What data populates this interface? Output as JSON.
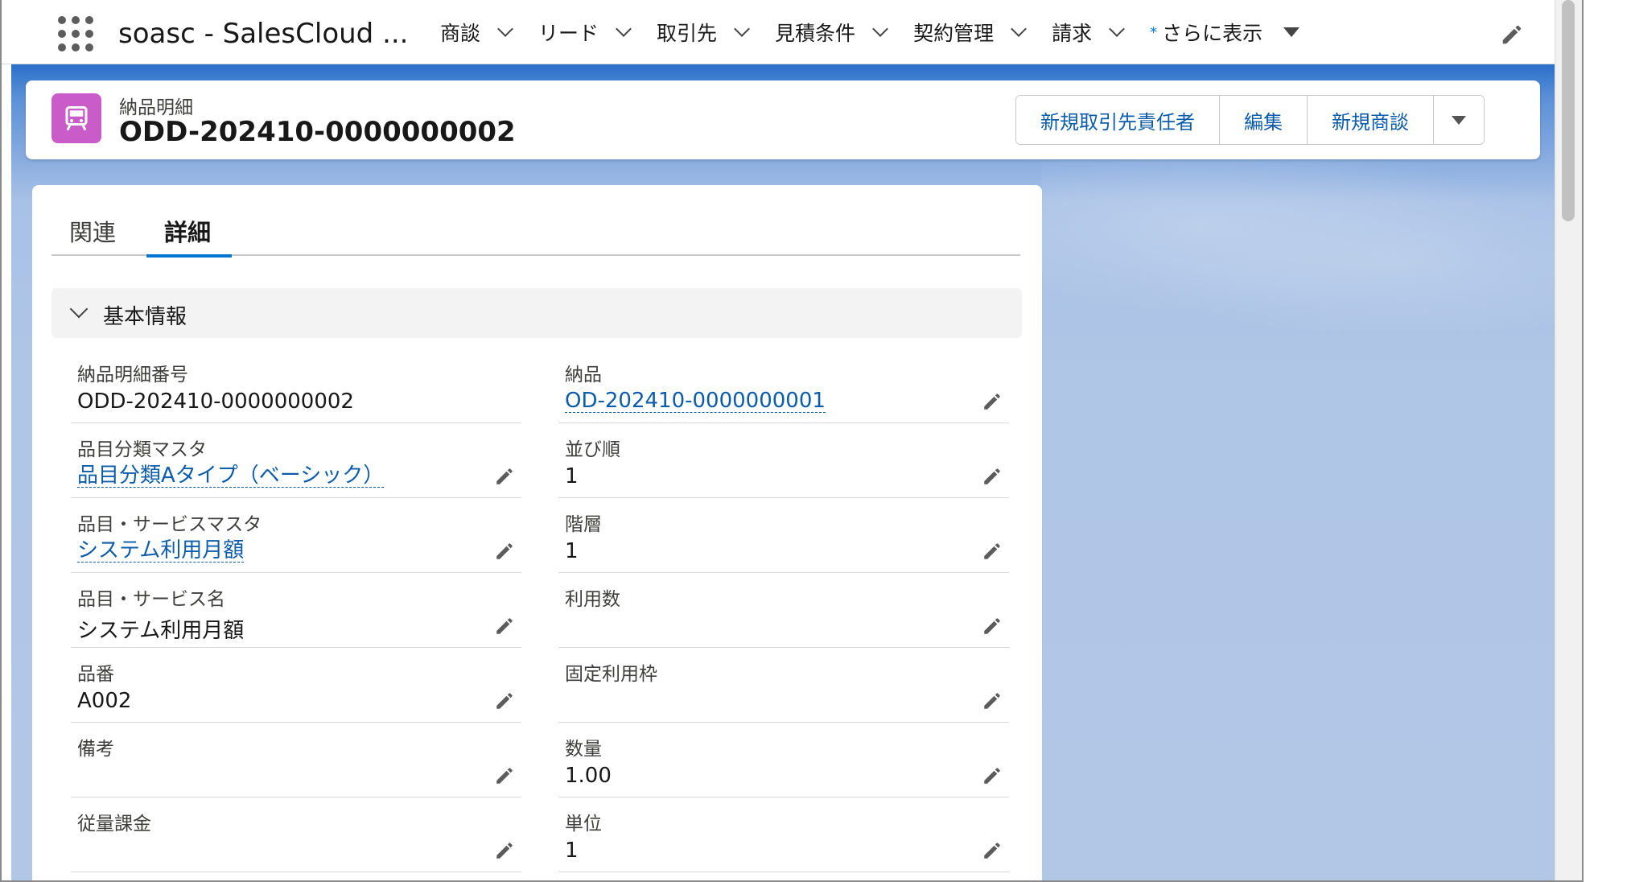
{
  "topnav": {
    "app_name": "soasc - SalesCloud ...",
    "items": [
      {
        "label": "商談"
      },
      {
        "label": "リード"
      },
      {
        "label": "取引先"
      },
      {
        "label": "見積条件"
      },
      {
        "label": "契約管理"
      },
      {
        "label": "請求"
      }
    ],
    "more": {
      "star": "*",
      "label": "さらに表示"
    }
  },
  "record": {
    "object_label": "納品明細",
    "title": "ODD-202410-0000000002",
    "icon": "delivery-icon",
    "icon_color": "#c95cc8"
  },
  "actions": {
    "new_contact": "新規取引先責任者",
    "edit": "編集",
    "new_opportunity": "新規商談"
  },
  "tabs": {
    "related": "関連",
    "details": "詳細"
  },
  "section": {
    "title": "基本情報"
  },
  "fields": {
    "left": [
      {
        "label": "納品明細番号",
        "value": "ODD-202410-0000000002"
      },
      {
        "label": "品目分類マスタ",
        "value": "品目分類Aタイプ（ベーシック）"
      },
      {
        "label": "品目・サービスマスタ",
        "value": "システム利用月額"
      },
      {
        "label": "品目・サービス名",
        "value": "システム利用月額"
      },
      {
        "label": "品番",
        "value": "A002"
      },
      {
        "label": "備考",
        "value": ""
      },
      {
        "label": "従量課金",
        "value": ""
      }
    ],
    "right": [
      {
        "label": "納品",
        "value": "OD-202410-0000000001"
      },
      {
        "label": "並び順",
        "value": "1"
      },
      {
        "label": "階層",
        "value": "1"
      },
      {
        "label": "利用数",
        "value": ""
      },
      {
        "label": "固定利用枠",
        "value": ""
      },
      {
        "label": "数量",
        "value": "1.00"
      },
      {
        "label": "単位",
        "value": "1"
      }
    ]
  },
  "colors": {
    "link": "#0b5cab",
    "accent": "#0176d3"
  }
}
